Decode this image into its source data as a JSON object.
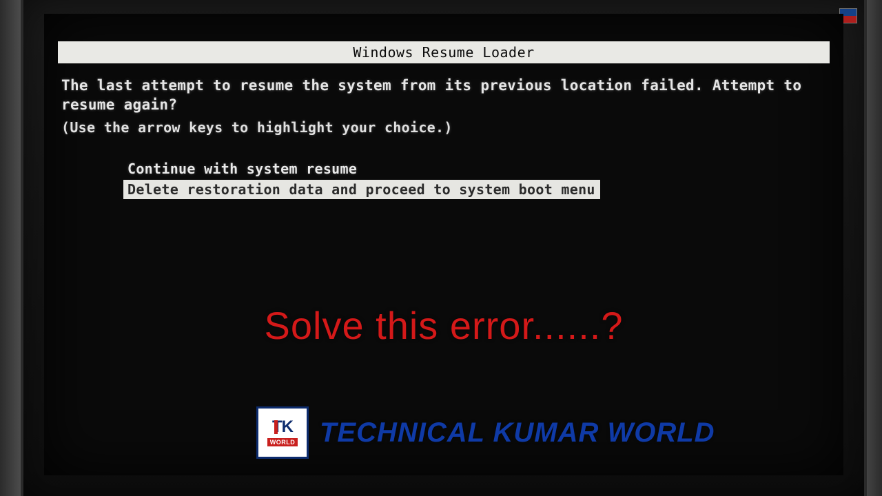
{
  "loader": {
    "title": "Windows Resume Loader",
    "message": "The last attempt to resume the system from its previous location failed. Attempt to resume again?",
    "hint": "(Use the arrow keys to highlight your choice.)",
    "options": {
      "continue": "Continue with system resume",
      "delete": "Delete restoration data and proceed to system boot menu"
    },
    "selected_index": 1
  },
  "overlay": {
    "caption": "Solve this error......?"
  },
  "brand": {
    "logo_main": "TK",
    "logo_sub": "WORLD",
    "text": "TECHNICAL KUMAR WORLD"
  }
}
